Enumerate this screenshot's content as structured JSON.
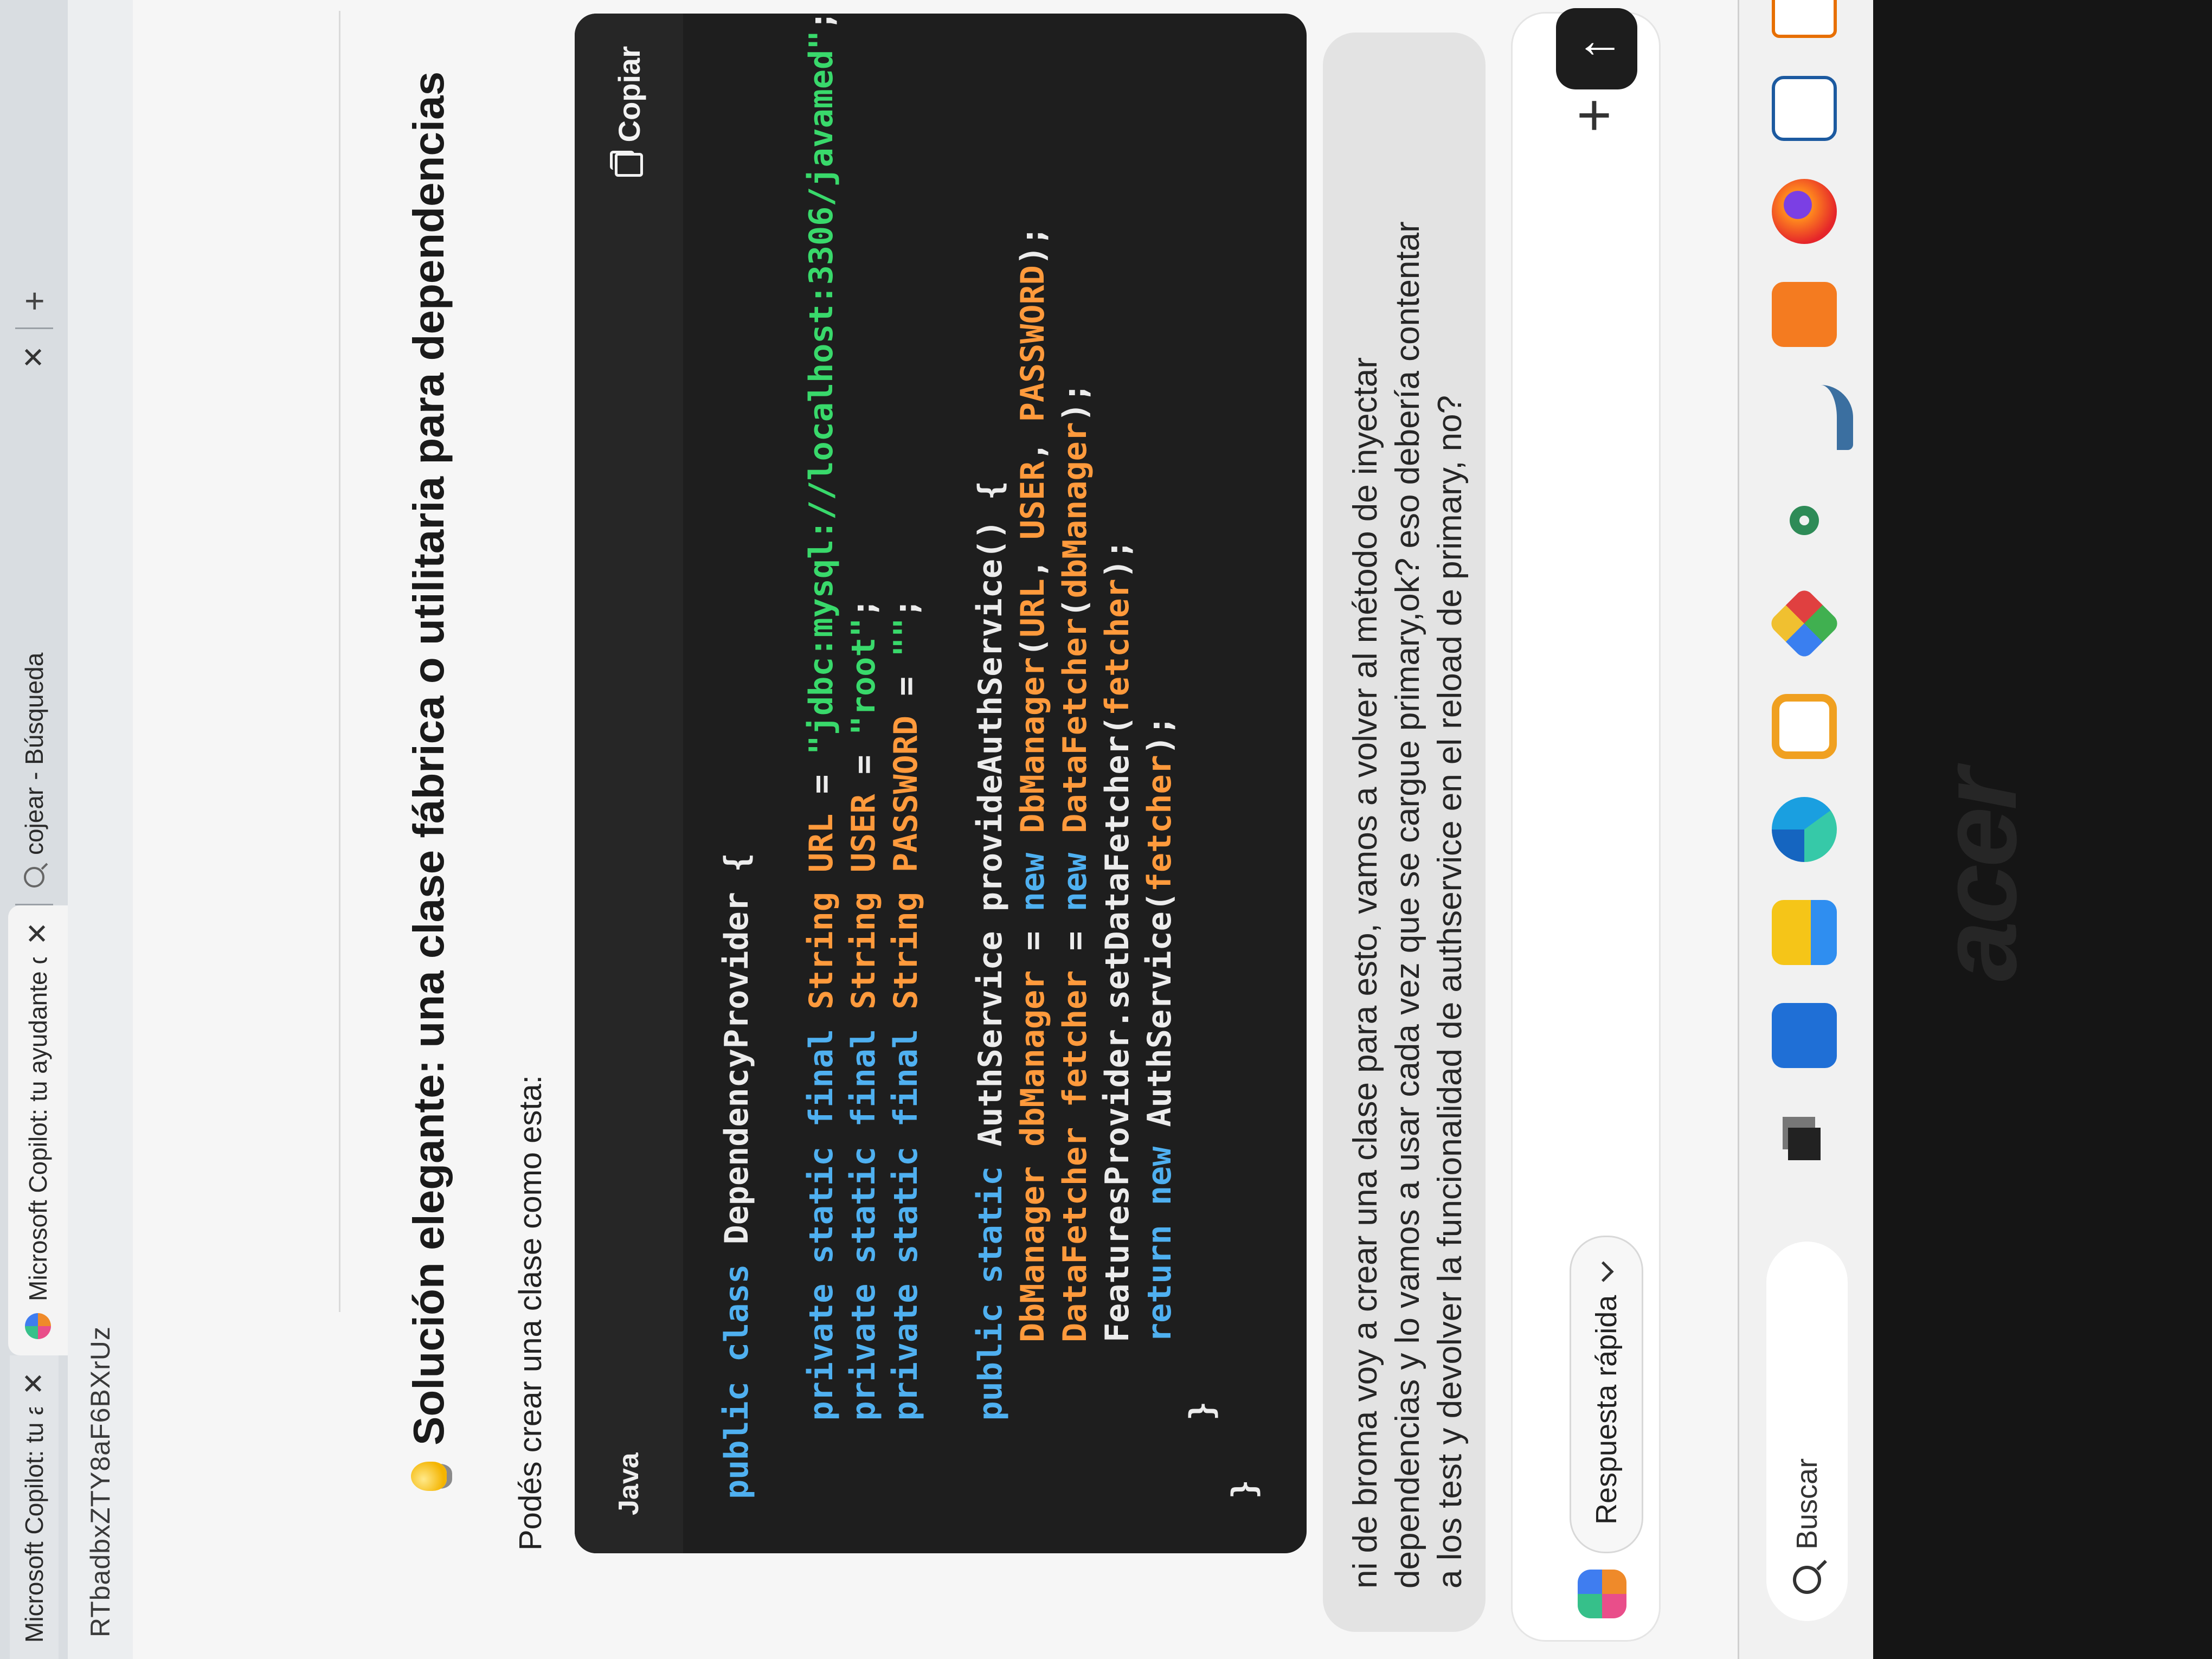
{
  "browser": {
    "tabs": [
      {
        "title": "Microsoft Copilot: tu ayudante de"
      },
      {
        "title": "Microsoft Copilot: tu ayudante de"
      },
      {
        "title": "cojear - Búsqueda"
      }
    ],
    "new_tab": "+",
    "address_fragment": "RTbadbxZTY8aF6BXrUz"
  },
  "response": {
    "heading": "Solución elegante: una clase fábrica o utilitaria para dependencias",
    "intro": "Podés crear una clase como esta:",
    "code_block": {
      "language": "Java",
      "copy_label": "Copiar",
      "lines": [
        "public class DependencyProvider {",
        "",
        "    private static final String URL = \"jdbc:mysql://localhost:3306/javamed\";",
        "    private static final String USER = \"root\";",
        "    private static final String PASSWORD = \"\";",
        "",
        "    public static AuthService provideAuthService() {",
        "        DbManager dbManager = new DbManager(URL, USER, PASSWORD);",
        "        DataFetcher fetcher = new DataFetcher(dbManager);",
        "        FeaturesProvider.setDataFetcher(fetcher);",
        "        return new AuthService(fetcher);",
        "    }",
        "}"
      ]
    }
  },
  "user_message": {
    "lines": [
      "ni de broma voy a crear una clase para esto, vamos a volver al método de inyectar",
      "dependencias y lo vamos a usar cada vez que se cargue primary,ok? eso debería contentar",
      "a los test y devolver la funcionalidad de authservice en el reload de primary, no?"
    ]
  },
  "composer": {
    "quick_reply_label": "Respuesta rápida",
    "plus": "+",
    "send": "↑"
  },
  "taskbar": {
    "search_label": "Buscar",
    "icons": [
      "task-view-icon",
      "store-icon",
      "file-explorer-icon",
      "edge-icon",
      "hex-app-icon",
      "paint-icon",
      "leaf-app-icon",
      "dolphin-app-icon",
      "xampp-icon",
      "firefox-icon",
      "document-app-icon",
      "java-app-icon"
    ]
  },
  "device": {
    "brand": "acer"
  },
  "colors": {
    "code_bg": "#1e1e1e",
    "keyword": "#4fb0f0",
    "variable": "#ff9a3c",
    "string": "#39d96b"
  }
}
